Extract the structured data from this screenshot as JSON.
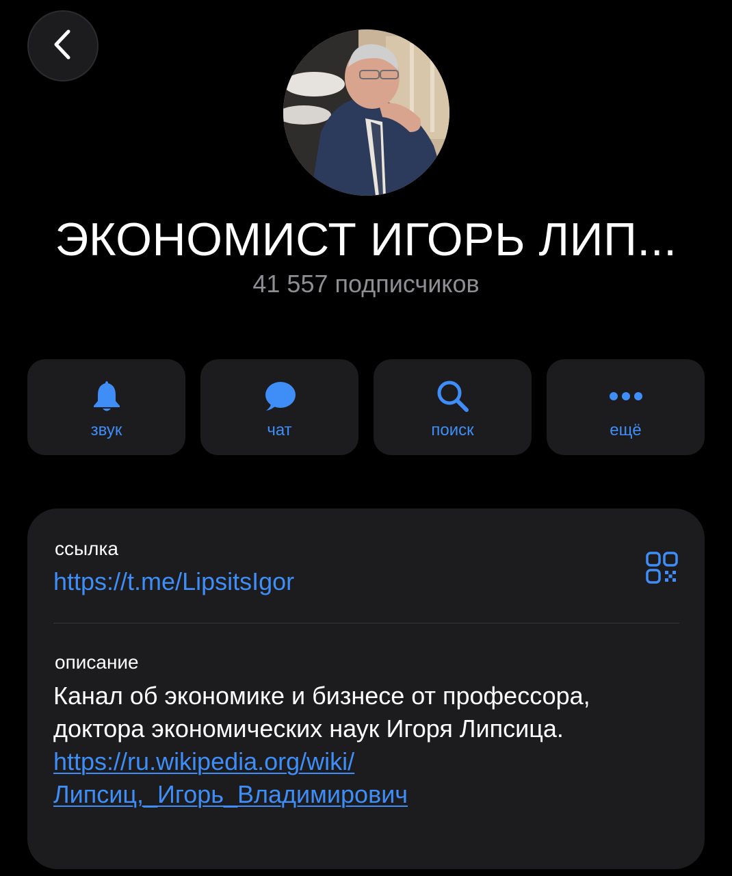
{
  "header": {
    "back_icon": "chevron-left-icon"
  },
  "channel": {
    "title": "ЭКОНОМИСТ ИГОРЬ ЛИП...",
    "subscribers": "41 557 подписчиков"
  },
  "actions": [
    {
      "label": "звук",
      "icon": "bell-icon"
    },
    {
      "label": "чат",
      "icon": "chat-bubble-icon"
    },
    {
      "label": "поиск",
      "icon": "search-icon"
    },
    {
      "label": "ещё",
      "icon": "more-dots-icon"
    }
  ],
  "info": {
    "link_label": "ссылка",
    "link_value": "https://t.me/LipsitsIgor",
    "qr_icon": "qr-code-icon",
    "description_label": "описание",
    "description_text": "Канал об экономике и бизнесе от профессора, доктора экономических наук Игоря Липсица.",
    "wiki_link_line1": "https://ru.wikipedia.org/wiki/",
    "wiki_link_line2": "Липсиц,_Игорь_Владимирович"
  },
  "colors": {
    "background": "#000000",
    "card": "#1c1c1e",
    "accent": "#3f8ef7",
    "secondary_text": "#8e8e93"
  }
}
